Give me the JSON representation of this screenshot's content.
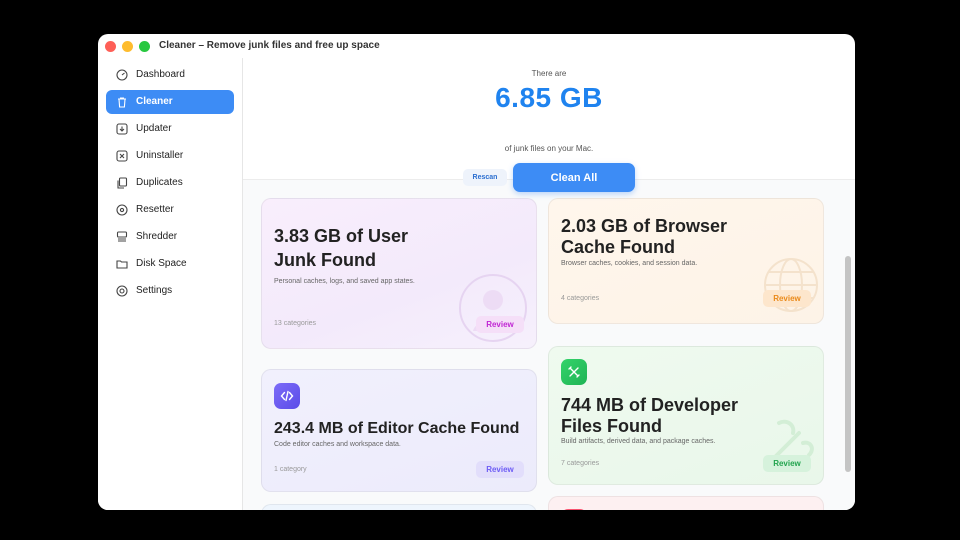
{
  "window": {
    "title": "Cleaner – Remove junk files and free up space"
  },
  "sidebar": {
    "items": [
      {
        "label": "Dashboard",
        "icon": "dashboard-icon",
        "active": false
      },
      {
        "label": "Cleaner",
        "icon": "trash-icon",
        "active": true
      },
      {
        "label": "Updater",
        "icon": "download-icon",
        "active": false
      },
      {
        "label": "Uninstaller",
        "icon": "x-box-icon",
        "active": false
      },
      {
        "label": "Duplicates",
        "icon": "copy-icon",
        "active": false
      },
      {
        "label": "Resetter",
        "icon": "reset-icon",
        "active": false
      },
      {
        "label": "Shredder",
        "icon": "shredder-icon",
        "active": false
      },
      {
        "label": "Disk Space",
        "icon": "folder-icon",
        "active": false
      },
      {
        "label": "Settings",
        "icon": "gear-icon",
        "active": false
      }
    ]
  },
  "header": {
    "pre": "There are",
    "amount": "6.85 GB",
    "post": "of junk files on your Mac.",
    "rescan_label": "Rescan",
    "clean_label": "Clean All"
  },
  "cards": {
    "user": {
      "title_line1": "3.83 GB of User",
      "title_line2": "Junk Found",
      "desc": "Personal caches, logs, and saved app states.",
      "count": "13 categories",
      "review": "Review",
      "color": "#c026d3"
    },
    "browser": {
      "title_line1": "2.03 GB of Browser",
      "title_line2": "Cache Found",
      "desc": "Browser caches, cookies, and session data.",
      "count": "4 categories",
      "review": "Review",
      "color": "#ea8a1a"
    },
    "editor": {
      "title": "243.4 MB of Editor Cache Found",
      "desc": "Code editor caches and workspace data.",
      "count": "1 category",
      "review": "Review",
      "color": "#6d5cf5"
    },
    "developer": {
      "title_line1": "744 MB of Developer",
      "title_line2": "Files Found",
      "desc": "Build artifacts, derived data, and package caches.",
      "count": "7 categories",
      "review": "Review",
      "color": "#22c55e"
    }
  },
  "colors": {
    "accent": "#3d8cf5",
    "amount": "#1f83ef"
  }
}
